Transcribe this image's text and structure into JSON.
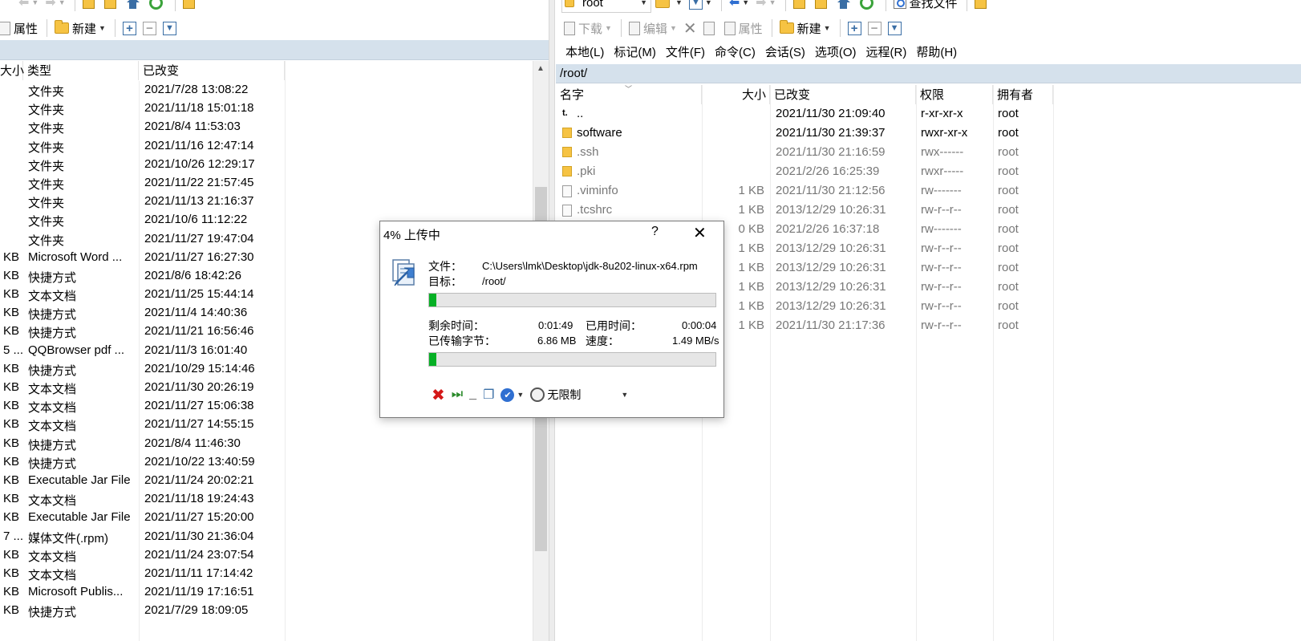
{
  "left_toolbar_top": {
    "arrows_disabled": true
  },
  "left_toolbar": {
    "properties": "属性",
    "new": "新建"
  },
  "left_columns": {
    "size": "大小",
    "type": "类型",
    "changed": "已改变"
  },
  "left_files": [
    {
      "size": "",
      "type": "文件夹",
      "changed": "2021/7/28  13:08:22"
    },
    {
      "size": "",
      "type": "文件夹",
      "changed": "2021/11/18  15:01:18"
    },
    {
      "size": "",
      "type": "文件夹",
      "changed": "2021/8/4  11:53:03"
    },
    {
      "size": "",
      "type": "文件夹",
      "changed": "2021/11/16  12:47:14"
    },
    {
      "size": "",
      "type": "文件夹",
      "changed": "2021/10/26  12:29:17"
    },
    {
      "size": "",
      "type": "文件夹",
      "changed": "2021/11/22  21:57:45"
    },
    {
      "size": "",
      "type": "文件夹",
      "changed": "2021/11/13  21:16:37"
    },
    {
      "size": "",
      "type": "文件夹",
      "changed": "2021/10/6  11:12:22"
    },
    {
      "size": "",
      "type": "文件夹",
      "changed": "2021/11/27  19:47:04"
    },
    {
      "size": "KB",
      "type": "Microsoft Word ...",
      "changed": "2021/11/27  16:27:30"
    },
    {
      "size": "KB",
      "type": "快捷方式",
      "changed": "2021/8/6  18:42:26"
    },
    {
      "size": "KB",
      "type": "文本文档",
      "changed": "2021/11/25  15:44:14"
    },
    {
      "size": "KB",
      "type": "快捷方式",
      "changed": "2021/11/4  14:40:36"
    },
    {
      "size": "KB",
      "type": "快捷方式",
      "changed": "2021/11/21  16:56:46"
    },
    {
      "size": "5 ...",
      "type": "QQBrowser pdf ...",
      "changed": "2021/11/3  16:01:40"
    },
    {
      "size": "KB",
      "type": "快捷方式",
      "changed": "2021/10/29  15:14:46"
    },
    {
      "size": "KB",
      "type": "文本文档",
      "changed": "2021/11/30  20:26:19"
    },
    {
      "size": "KB",
      "type": "文本文档",
      "changed": "2021/11/27  15:06:38"
    },
    {
      "size": "KB",
      "type": "文本文档",
      "changed": "2021/11/27  14:55:15"
    },
    {
      "size": "KB",
      "type": "快捷方式",
      "changed": "2021/8/4  11:46:30"
    },
    {
      "size": "KB",
      "type": "快捷方式",
      "changed": "2021/10/22  13:40:59"
    },
    {
      "size": "KB",
      "type": "Executable Jar File",
      "changed": "2021/11/24  20:02:21"
    },
    {
      "size": "KB",
      "type": "文本文档",
      "changed": "2021/11/18  19:24:43"
    },
    {
      "size": "KB",
      "type": "Executable Jar File",
      "changed": "2021/11/27  15:20:00"
    },
    {
      "size": "7 ...",
      "type": "媒体文件(.rpm)",
      "changed": "2021/11/30  21:36:04"
    },
    {
      "size": "KB",
      "type": "文本文档",
      "changed": "2021/11/24  23:07:54"
    },
    {
      "size": "KB",
      "type": "文本文档",
      "changed": "2021/11/11  17:14:42"
    },
    {
      "size": "KB",
      "type": "Microsoft Publis...",
      "changed": "2021/11/19  17:16:51"
    },
    {
      "size": "KB",
      "type": "快捷方式",
      "changed": "2021/7/29  18:09:05"
    }
  ],
  "right_toolbar_top": {
    "location": "root",
    "find_files": "查找文件"
  },
  "right_toolbar": {
    "download": "下载",
    "edit": "编辑",
    "properties": "属性",
    "new": "新建"
  },
  "right_menu": [
    "本地(L)",
    "标记(M)",
    "文件(F)",
    "命令(C)",
    "会话(S)",
    "选项(O)",
    "远程(R)",
    "帮助(H)"
  ],
  "right_path": "/root/",
  "right_columns": {
    "name": "名字",
    "size": "大小",
    "changed": "已改变",
    "rights": "权限",
    "owner": "拥有者"
  },
  "right_files": [
    {
      "icon": "up",
      "name": "..",
      "size": "",
      "changed": "2021/11/30 21:09:40",
      "rights": "r-xr-xr-x",
      "owner": "root",
      "dim": false
    },
    {
      "icon": "folder",
      "name": "software",
      "size": "",
      "changed": "2021/11/30 21:39:37",
      "rights": "rwxr-xr-x",
      "owner": "root",
      "dim": false
    },
    {
      "icon": "folder",
      "name": ".ssh",
      "size": "",
      "changed": "2021/11/30 21:16:59",
      "rights": "rwx------",
      "owner": "root",
      "dim": true
    },
    {
      "icon": "folder",
      "name": ".pki",
      "size": "",
      "changed": "2021/2/26 16:25:39",
      "rights": "rwxr-----",
      "owner": "root",
      "dim": true
    },
    {
      "icon": "file",
      "name": ".viminfo",
      "size": "1 KB",
      "changed": "2021/11/30 21:12:56",
      "rights": "rw-------",
      "owner": "root",
      "dim": true
    },
    {
      "icon": "file",
      "name": ".tcshrc",
      "size": "1 KB",
      "changed": "2013/12/29 10:26:31",
      "rights": "rw-r--r--",
      "owner": "root",
      "dim": true
    },
    {
      "icon": "",
      "name": "",
      "size": "0 KB",
      "changed": "2021/2/26 16:37:18",
      "rights": "rw-------",
      "owner": "root",
      "dim": true
    },
    {
      "icon": "",
      "name": "",
      "size": "1 KB",
      "changed": "2013/12/29 10:26:31",
      "rights": "rw-r--r--",
      "owner": "root",
      "dim": true
    },
    {
      "icon": "",
      "name": "",
      "size": "1 KB",
      "changed": "2013/12/29 10:26:31",
      "rights": "rw-r--r--",
      "owner": "root",
      "dim": true
    },
    {
      "icon": "",
      "name": "",
      "size": "1 KB",
      "changed": "2013/12/29 10:26:31",
      "rights": "rw-r--r--",
      "owner": "root",
      "dim": true
    },
    {
      "icon": "",
      "name": "",
      "size": "1 KB",
      "changed": "2013/12/29 10:26:31",
      "rights": "rw-r--r--",
      "owner": "root",
      "dim": true
    },
    {
      "icon": "",
      "name": "",
      "size": "1 KB",
      "changed": "2021/11/30 21:17:36",
      "rights": "rw-r--r--",
      "owner": "root",
      "dim": true
    }
  ],
  "dialog": {
    "title": "4% 上传中",
    "help": "?",
    "close": "✕",
    "file_label": "文件：",
    "file_value": "C:\\Users\\lmk\\Desktop\\jdk-8u202-linux-x64.rpm",
    "target_label": "目标：",
    "target_value": "/root/",
    "file_progress": 0.025,
    "time_left_label": "剩余时间：",
    "time_left": "0:01:49",
    "time_elapsed_label": "已用时间：",
    "time_elapsed": "0:00:04",
    "bytes_label": "已传输字节：",
    "bytes": "6.86 MB",
    "speed_label": "速度：",
    "speed": "1.49 MB/s",
    "total_progress": 0.025,
    "speed_limit": "无限制"
  }
}
